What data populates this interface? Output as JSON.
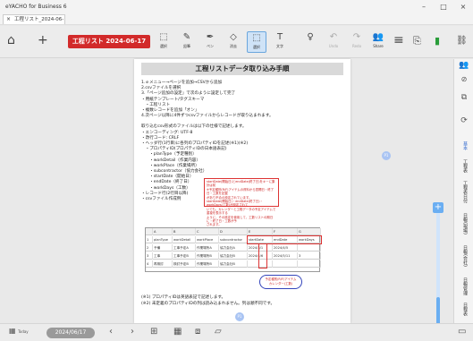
{
  "window": {
    "title": "eYACHO for Business 6",
    "minimize": "–",
    "maximize": "□",
    "close": "×"
  },
  "tab": {
    "label": "工程リスト_2024-06-17",
    "close": "×"
  },
  "toolbar": {
    "doc_title": "工程リスト 2024-06-17",
    "tools": [
      {
        "label": "選択",
        "glyph": "⬚"
      },
      {
        "label": "鉛筆",
        "glyph": "✎"
      },
      {
        "label": "ペン",
        "glyph": "✒"
      },
      {
        "label": "消去",
        "glyph": "◇"
      },
      {
        "label": "選択",
        "glyph": "⬚"
      },
      {
        "label": "文字",
        "glyph": "T"
      },
      {
        "label": "",
        "glyph": "♀"
      },
      {
        "label": "Undo",
        "glyph": "↶"
      },
      {
        "label": "Redo",
        "glyph": "↷"
      },
      {
        "label": "Share",
        "glyph": "👥"
      }
    ],
    "menu_glyph": "≡",
    "save_glyph": "⎘",
    "book_glyph": "▮",
    "link_glyph": "⛓"
  },
  "document": {
    "heading": "工程リストデータ取り込み手順",
    "steps": [
      "1.ｅメニュー→ページを追加→CSVから追加",
      "2.csvファイルを選択",
      "3.「ページ追加の設定」で次のように設定して完了",
      "・用紙テンプレート/タグスキーマ",
      "　・工程リスト",
      "・複数レコードを追加「オン」",
      "4.次ページ以降に4件ずつcsvファイルからレコードが取り込まれます。"
    ],
    "spec_intro": "取り込むcsv形式のファイルは以下の仕様で記述します。",
    "spec": [
      "・エンコーディング: UTF-8",
      "・改行コード: CRLF",
      "・ヘッダ行(1行目)に各列のプロパティIDを記述(※1)(※2)",
      "　・プロパティID(プロパティIDの日本語表記)",
      "　　・planType（予定種別）",
      "　　・workDetail（作業内容）",
      "　　・workPlace（作業場所）",
      "　　・subcontractor（協力会社）",
      "　　・startDate（開始日）",
      "　　・endDate（終了日）",
      "　　・workDays（工数）",
      "・レコード行(2行目以降)",
      "・csvファイル作成例"
    ],
    "callout": [
      "startDate(開始日)とendDate(終了日)をキーに集計は前",
      "※予定種別(R/F)アイテムの資料から週開日・終了日・工数を記載",
      "があり不合の設定されています。",
      "startDate(開始日)・endDate(終了日)・workDays(工数)が設定されて",
      "いても、カレンダーと工程データの予定アイテムで重複を表示する",
      "ように、その設定を使用して、工数リストの期日に・終了日・工数が予",
      "されます。"
    ],
    "sheet_header": [
      "",
      "A",
      "B",
      "C",
      "D",
      "E",
      "F",
      "G"
    ],
    "sheet_rows": [
      [
        "1",
        "planType",
        "workDetail",
        "workPlace",
        "subcontractor",
        "startDate",
        "endDate",
        "workDays"
      ],
      [
        "2",
        "予備",
        "工事予定A",
        "作業場所A",
        "協力会社A",
        "2024/3/1",
        "2024/4/5",
        ""
      ],
      [
        "3",
        "工事",
        "工事予定B",
        "作業場所B",
        "協力会社B",
        "2024/4/6",
        "2024/5/11",
        "3"
      ],
      [
        "4",
        "再検討",
        "検討予定B",
        "作業場所B",
        "協力会社B",
        "",
        "",
        ""
      ]
    ],
    "bubble": [
      "予定種別(R/F)アイテム",
      "カレンダー(工数)"
    ],
    "notes": [
      "(※1) プロパティIDは英語表記で記述します。",
      "(※2) 未定義のプロパティIDの列は読み込まれません。列は順不同です。"
    ],
    "page_marker": "P1",
    "float_marker": "P1"
  },
  "zoom": {
    "plus": "+",
    "minus": "−",
    "level": 0.25
  },
  "right_panel": {
    "labels": [
      "基本",
      "工程表",
      "工程表日付",
      "日報(現場)",
      "日報(会社)",
      "日報管理",
      "日程表"
    ]
  },
  "bottom": {
    "today_label": "Today",
    "date": "2024/06/17",
    "prev": "‹",
    "next": "›"
  }
}
